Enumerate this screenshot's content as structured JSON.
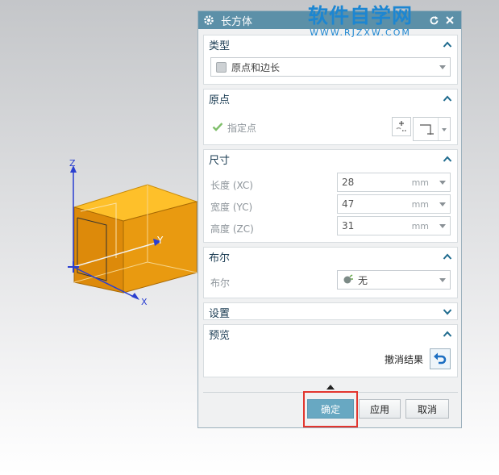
{
  "watermark": {
    "title": "软件自学网",
    "url": "WWW.RJZXW.COM"
  },
  "viewport": {
    "axis_z": "Z",
    "axis_y": "Y",
    "axis_x": "X"
  },
  "dialog": {
    "title": "长方体",
    "groups": {
      "type": {
        "title": "类型",
        "selected": "原点和边长"
      },
      "origin": {
        "title": "原点",
        "specify_point": "指定点"
      },
      "size": {
        "title": "尺寸",
        "rows": [
          {
            "label": "长度 (XC)",
            "value": "28",
            "unit": "mm"
          },
          {
            "label": "宽度 (YC)",
            "value": "47",
            "unit": "mm"
          },
          {
            "label": "高度 (ZC)",
            "value": "31",
            "unit": "mm"
          }
        ]
      },
      "boolean": {
        "title": "布尔",
        "label": "布尔",
        "value": "无"
      },
      "settings": {
        "title": "设置"
      },
      "preview": {
        "title": "预览",
        "undo_label": "撤消结果"
      }
    },
    "buttons": {
      "ok": "确定",
      "apply": "应用",
      "cancel": "取消"
    }
  },
  "colors": {
    "titlebar": "#5c90a8",
    "box_top": "#fec02a",
    "box_front": "#e89a0c",
    "highlight": "#e2352e"
  }
}
